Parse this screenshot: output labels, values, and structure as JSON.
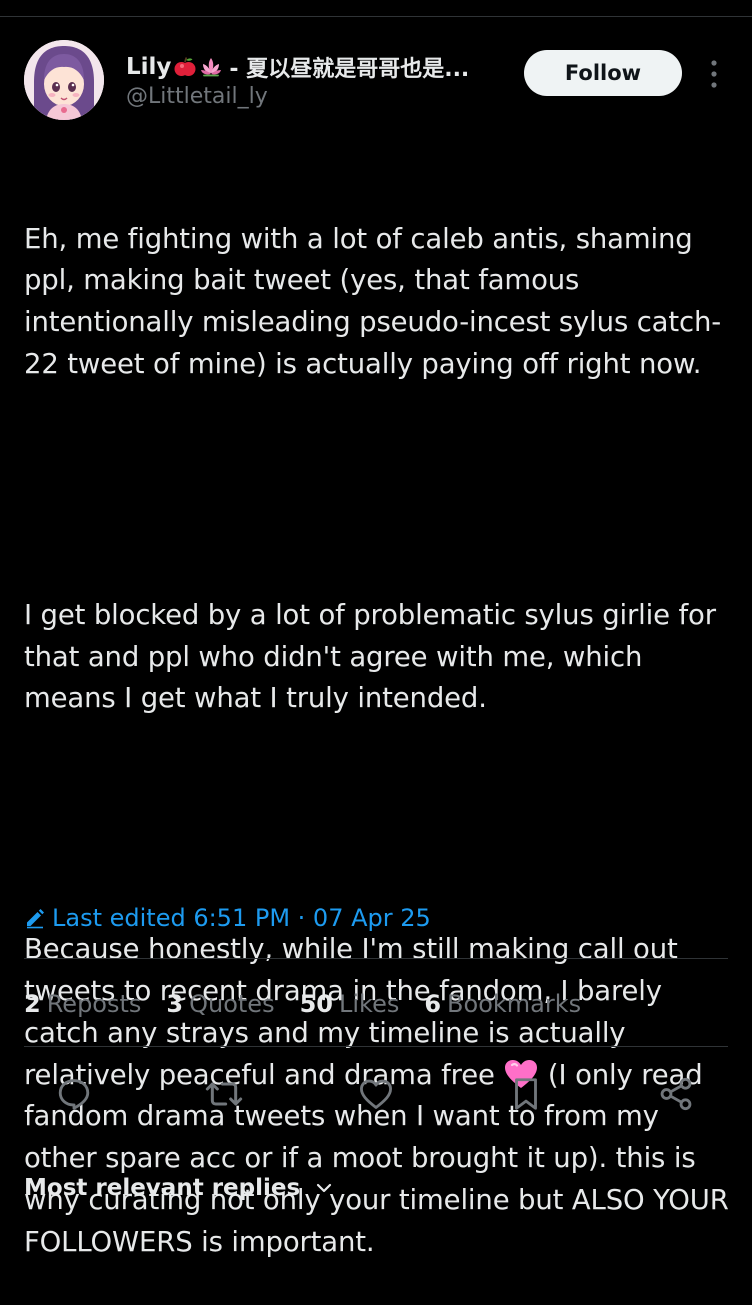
{
  "author": {
    "display_name": "Lily",
    "display_name_suffix": "- 夏以昼就是哥哥也是...",
    "handle": "@Littletail_ly"
  },
  "header": {
    "follow_label": "Follow"
  },
  "tweet": {
    "paragraphs": [
      "Eh, me fighting with a lot of caleb antis, shaming ppl, making bait tweet (yes, that famous intentionally misleading pseudo-incest sylus catch-22 tweet of mine) is actually paying off right now.",
      "I get blocked by a lot of problematic sylus girlie for that and ppl who didn't agree with me, which means I get what I truly intended."
    ],
    "para3_before_emoji": "Because honestly, while I'm still making call out tweets to recent drama in the fandom, I barely catch any strays and my timeline is actually relatively peaceful and drama free ",
    "para3_after_emoji": " (I only read fandom drama tweets when I want to from my other spare acc or if a moot brought it up). this is why curating not only your timeline but ALSO YOUR FOLLOWERS is important."
  },
  "edited": {
    "text": "Last edited 6:51 PM · 07 Apr 25"
  },
  "stats": [
    {
      "count": "2",
      "label": "Reposts"
    },
    {
      "count": "3",
      "label": "Quotes"
    },
    {
      "count": "50",
      "label": "Likes"
    },
    {
      "count": "6",
      "label": "Bookmarks"
    }
  ],
  "actions": [
    "reply-icon",
    "repost-icon",
    "like-icon",
    "bookmark-icon",
    "share-icon"
  ],
  "replies": {
    "sort_label": "Most relevant replies"
  },
  "colors": {
    "background": "#000000",
    "text": "#e7e9ea",
    "secondary": "#71767b",
    "accent": "#1d9bf0",
    "divider": "#2f3336",
    "follow_bg": "#eff3f4"
  }
}
